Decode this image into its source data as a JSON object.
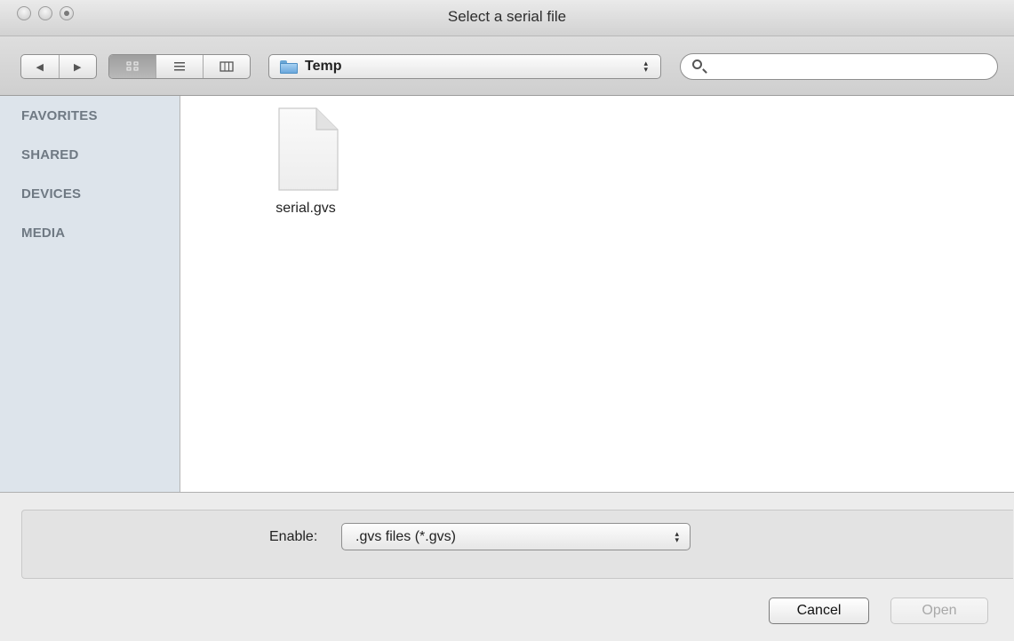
{
  "window": {
    "title": "Select a serial file"
  },
  "toolbar": {
    "back_icon": "◀",
    "forward_icon": "▶",
    "views": [
      {
        "name": "icon-view",
        "glyph": "▫▫",
        "active": true
      },
      {
        "name": "list-view",
        "glyph": "≡",
        "active": false
      },
      {
        "name": "column-view",
        "glyph": "▥",
        "active": false
      }
    ],
    "location": "Temp",
    "search_value": ""
  },
  "sidebar": {
    "items": [
      {
        "label": "FAVORITES"
      },
      {
        "label": "SHARED"
      },
      {
        "label": "DEVICES"
      },
      {
        "label": "MEDIA"
      }
    ]
  },
  "files": [
    {
      "name": "serial.gvs",
      "icon": "document-icon"
    }
  ],
  "options": {
    "enable_label": "Enable:",
    "filter_value": ".gvs files (*.gvs)"
  },
  "buttons": {
    "cancel": "Cancel",
    "open": "Open"
  },
  "colors": {
    "sidebar_bg": "#dde4eb",
    "sidebar_text": "#6f7983",
    "folder_blue": "#6ba8dc"
  }
}
